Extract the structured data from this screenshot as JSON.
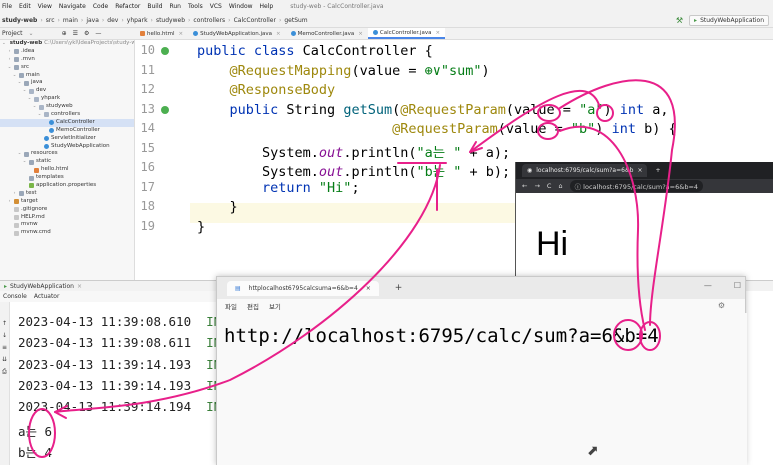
{
  "menu": {
    "items": [
      "File",
      "Edit",
      "View",
      "Navigate",
      "Code",
      "Refactor",
      "Build",
      "Run",
      "Tools",
      "VCS",
      "Window",
      "Help"
    ],
    "window_title": "study-web - CalcController.java"
  },
  "breadcrumb": {
    "items": [
      "study-web",
      "src",
      "main",
      "java",
      "dev",
      "yhpark",
      "studyweb",
      "controllers",
      "CalcController",
      "getSum"
    ]
  },
  "toolbar": {
    "run_config": "StudyWebApplication"
  },
  "project_panel": {
    "header": "Project",
    "tree": [
      {
        "label": "study-web",
        "extra": "C:\\Users\\ykl\\IdeaProjects\\study-web",
        "depth": 0,
        "icon": "folder-icon",
        "open": true
      },
      {
        "label": ".idea",
        "depth": 1,
        "icon": "folder-icon",
        "open": false
      },
      {
        "label": ".mvn",
        "depth": 1,
        "icon": "folder-icon",
        "open": false
      },
      {
        "label": "src",
        "depth": 1,
        "icon": "folder-icon",
        "open": true
      },
      {
        "label": "main",
        "depth": 2,
        "icon": "folder-icon",
        "open": true
      },
      {
        "label": "java",
        "depth": 3,
        "icon": "folder-icon",
        "open": true
      },
      {
        "label": "dev",
        "depth": 4,
        "icon": "package-icon",
        "open": true
      },
      {
        "label": "yhpark",
        "depth": 5,
        "icon": "package-icon",
        "open": true
      },
      {
        "label": "studyweb",
        "depth": 6,
        "icon": "package-icon",
        "open": true
      },
      {
        "label": "controllers",
        "depth": 7,
        "icon": "package-icon",
        "open": true
      },
      {
        "label": "CalcController",
        "depth": 8,
        "icon": "class-icon",
        "selected": true
      },
      {
        "label": "MemoController",
        "depth": 8,
        "icon": "class-icon"
      },
      {
        "label": "ServletInitializer",
        "depth": 7,
        "icon": "class-icon"
      },
      {
        "label": "StudyWebApplication",
        "depth": 7,
        "icon": "class-icon"
      },
      {
        "label": "resources",
        "depth": 3,
        "icon": "folder-icon",
        "open": true
      },
      {
        "label": "static",
        "depth": 4,
        "icon": "folder-icon",
        "open": true
      },
      {
        "label": "hello.html",
        "depth": 5,
        "icon": "html-icon"
      },
      {
        "label": "templates",
        "depth": 4,
        "icon": "folder-icon"
      },
      {
        "label": "application.properties",
        "depth": 4,
        "icon": "xml-icon"
      },
      {
        "label": "test",
        "depth": 2,
        "icon": "folder-icon",
        "open": false
      },
      {
        "label": "target",
        "depth": 1,
        "icon": "target-icon",
        "open": false
      },
      {
        "label": ".gitignore",
        "depth": 1,
        "icon": "file-icon"
      },
      {
        "label": "HELP.md",
        "depth": 1,
        "icon": "file-icon"
      },
      {
        "label": "mvnw",
        "depth": 1,
        "icon": "file-icon"
      },
      {
        "label": "mvnw.cmd",
        "depth": 1,
        "icon": "file-icon"
      }
    ]
  },
  "tabs": [
    {
      "label": "hello.html",
      "active": false
    },
    {
      "label": "StudyWebApplication.java",
      "active": false
    },
    {
      "label": "MemoController.java",
      "active": false
    },
    {
      "label": "CalcController.java",
      "active": true
    }
  ],
  "editor": {
    "line_numbers": [
      "10",
      "11",
      "12",
      "13",
      "14",
      "15",
      "16",
      "17",
      "18",
      "19"
    ],
    "lines": [
      [
        {
          "t": "kw",
          "v": "public class "
        },
        {
          "t": "",
          "v": "CalcController {"
        }
      ],
      [
        {
          "t": "ann",
          "v": "    @RequestMapping"
        },
        {
          "t": "",
          "v": "(value = "
        },
        {
          "t": "str",
          "v": "⊕∨\"sum\""
        },
        {
          "t": "",
          "v": ")"
        }
      ],
      [
        {
          "t": "ann",
          "v": "    @ResponseBody"
        }
      ],
      [
        {
          "t": "kw",
          "v": "    public "
        },
        {
          "t": "",
          "v": "String "
        },
        {
          "t": "fn",
          "v": "getSum"
        },
        {
          "t": "",
          "v": "("
        },
        {
          "t": "ann",
          "v": "@RequestParam"
        },
        {
          "t": "",
          "v": "(value = "
        },
        {
          "t": "str",
          "v": "\"a\""
        },
        {
          "t": "",
          "v": ") "
        },
        {
          "t": "kw",
          "v": "int "
        },
        {
          "t": "",
          "v": "a,"
        }
      ],
      [
        {
          "t": "",
          "v": "                        "
        },
        {
          "t": "ann",
          "v": "@RequestParam"
        },
        {
          "t": "",
          "v": "(value = "
        },
        {
          "t": "str",
          "v": "\"b\""
        },
        {
          "t": "",
          "v": ") "
        },
        {
          "t": "kw",
          "v": "int "
        },
        {
          "t": "",
          "v": "b) {"
        }
      ],
      [
        {
          "t": "",
          "v": "        System."
        },
        {
          "t": "st",
          "v": "out"
        },
        {
          "t": "",
          "v": ".println("
        },
        {
          "t": "str",
          "v": "\"a는 \""
        },
        {
          "t": "",
          "v": " + a);"
        }
      ],
      [
        {
          "t": "",
          "v": "        System."
        },
        {
          "t": "st",
          "v": "out"
        },
        {
          "t": "",
          "v": ".println("
        },
        {
          "t": "str",
          "v": "\"b는 \""
        },
        {
          "t": "",
          "v": " + b);"
        }
      ],
      [
        {
          "t": "kw",
          "v": "        return "
        },
        {
          "t": "str",
          "v": "\"Hi\""
        },
        {
          "t": "",
          "v": ";"
        }
      ],
      [
        {
          "t": "",
          "v": "    }"
        }
      ],
      [
        {
          "t": "",
          "v": "}"
        }
      ]
    ]
  },
  "browser": {
    "tab_title": "localhost:6795/calc/sum?a=6&b",
    "address": "localhost:6795/calc/sum?a=6&b=4",
    "body_text": "Hi"
  },
  "run_panel": {
    "header": "StudyWebApplication",
    "tabs": [
      "Console",
      "Actuator"
    ],
    "logs": [
      {
        "ts": "2023-04-13 11:39:08.610",
        "lvl": "INF"
      },
      {
        "ts": "2023-04-13 11:39:08.611",
        "lvl": "INF"
      },
      {
        "ts": "2023-04-13 11:39:14.193",
        "lvl": "INF"
      },
      {
        "ts": "2023-04-13 11:39:14.193",
        "lvl": "INF"
      },
      {
        "ts": "2023-04-13 11:39:14.194",
        "lvl": "INF"
      }
    ],
    "output": [
      "a는 6",
      "b는 4"
    ]
  },
  "notepad": {
    "tab_title": "httplocalhost6795calcsuma=6&b=4",
    "menu": [
      "파일",
      "편집",
      "보기"
    ],
    "text": "http://localhost:6795/calc/sum?a=6&b=4"
  },
  "colors": {
    "annotation": "#e8208a",
    "accent": "#4a86e8"
  }
}
